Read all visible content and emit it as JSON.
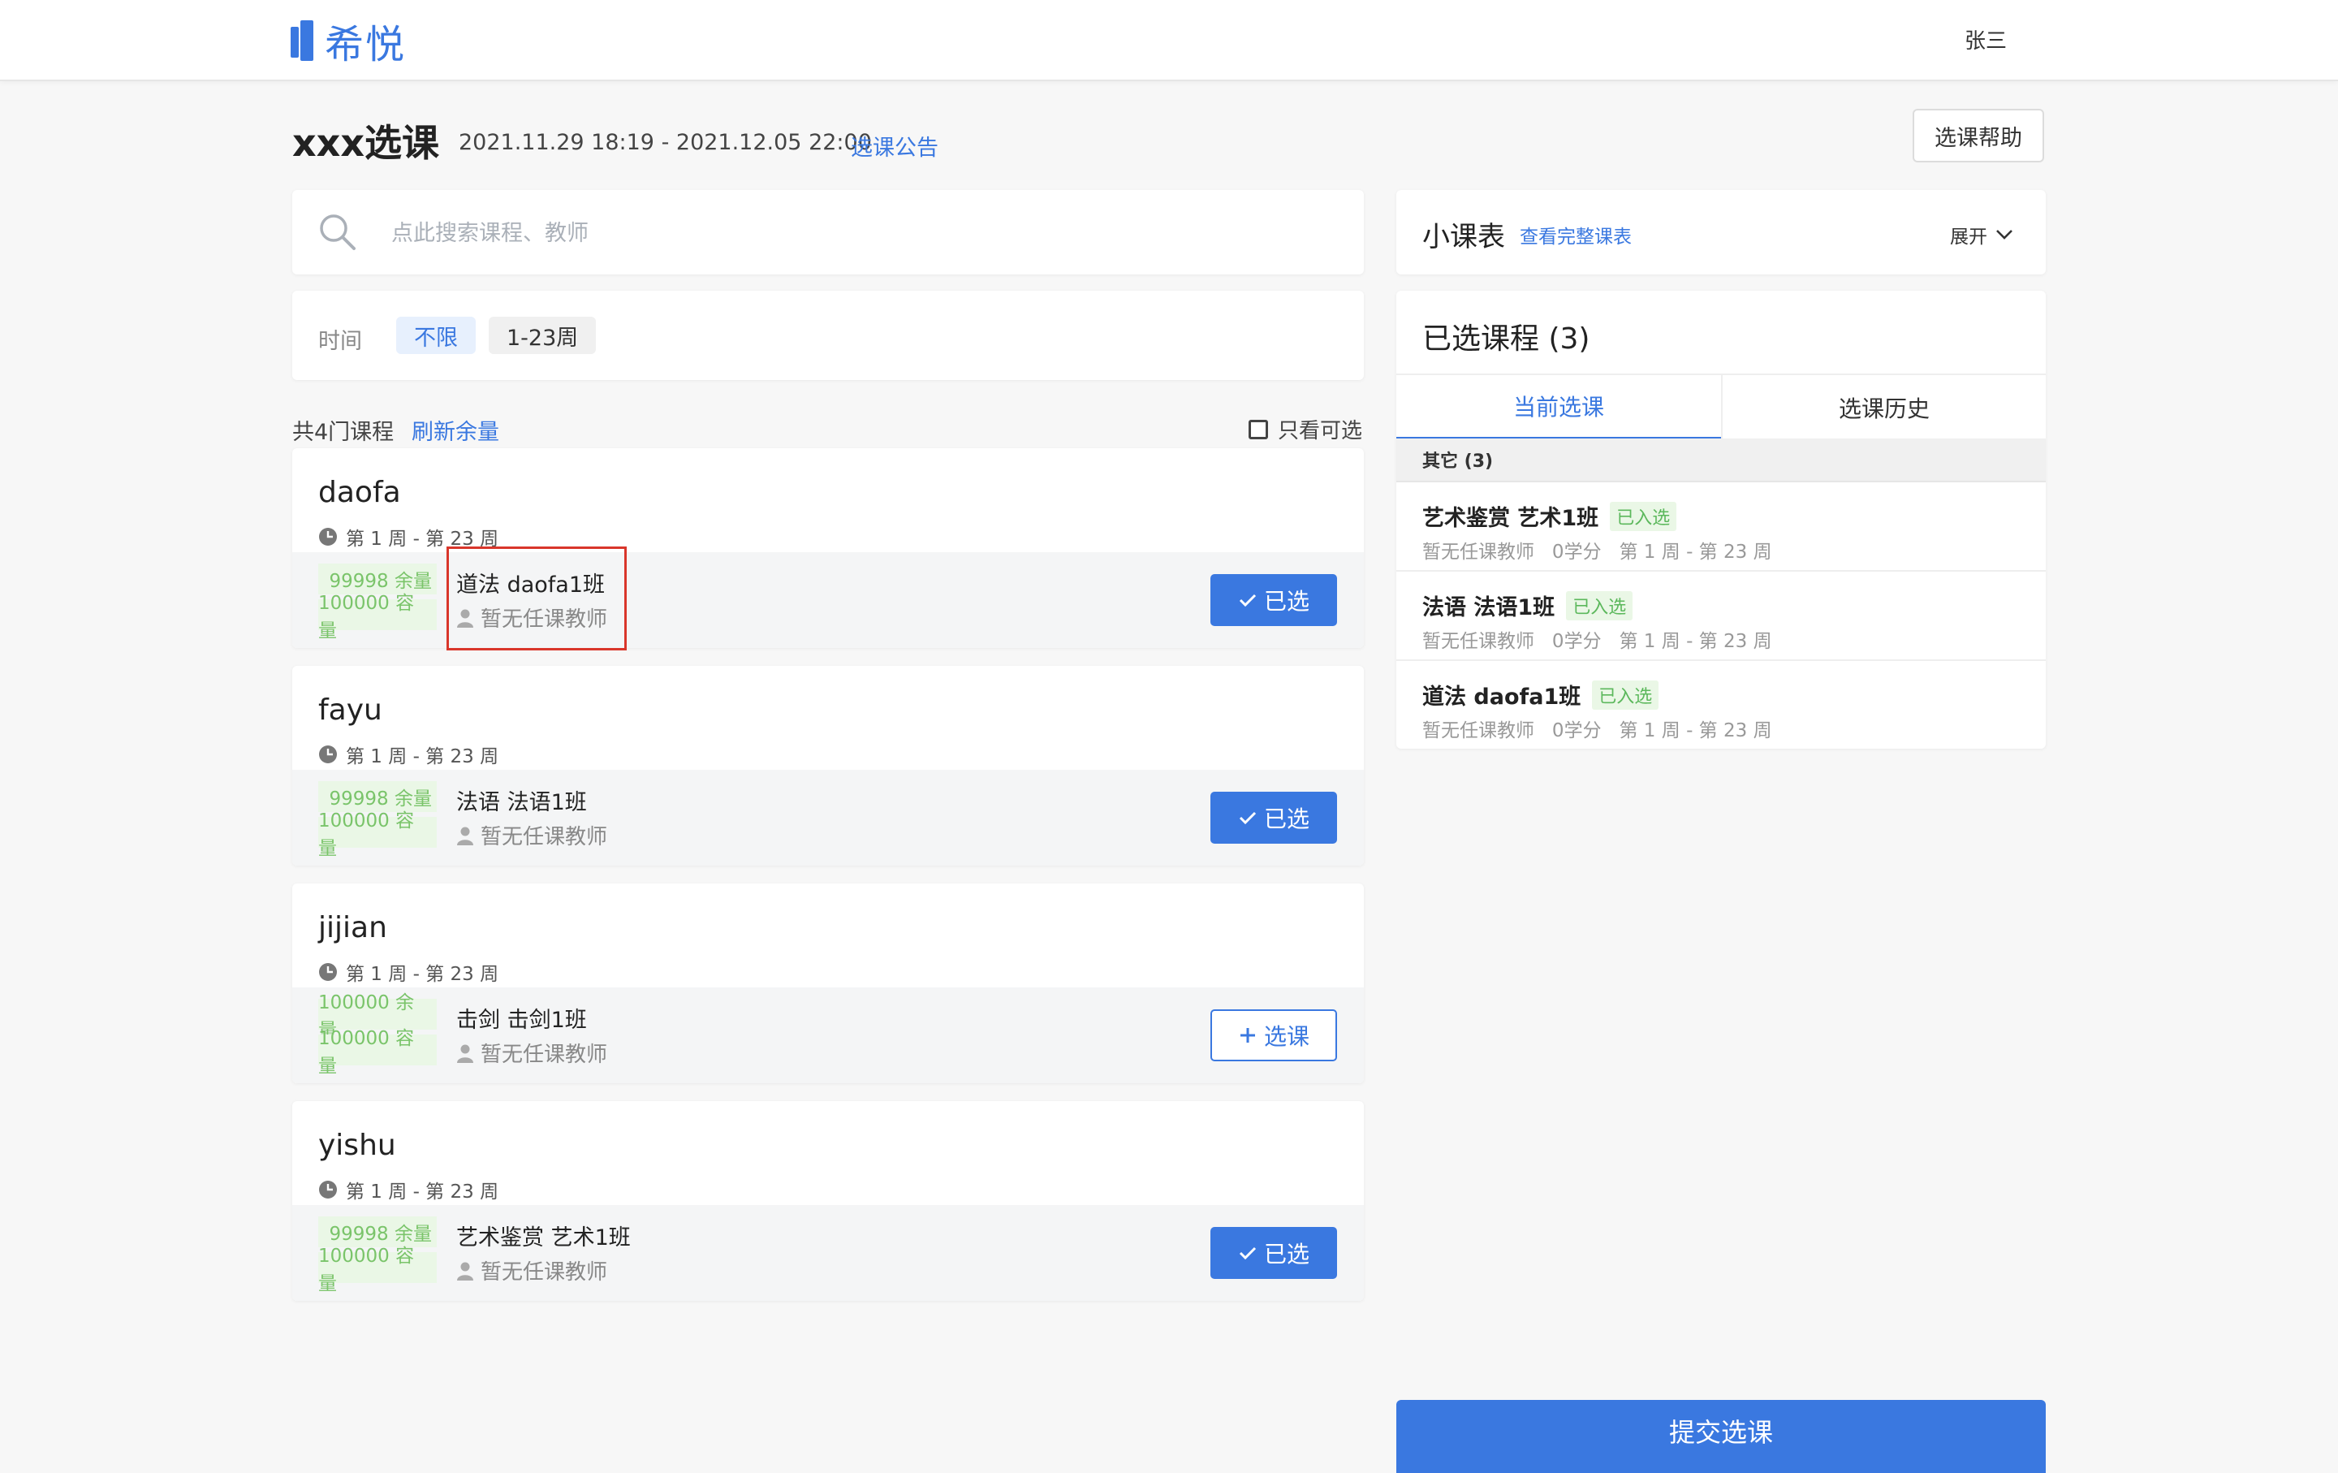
{
  "header": {
    "logo_text": "希悦",
    "user_name": "张三"
  },
  "title_row": {
    "title": "xxx选课",
    "date_range": "2021.11.29 18:19 - 2021.12.05 22:00",
    "notice_link": "选课公告",
    "help_button": "选课帮助"
  },
  "search": {
    "placeholder": "点此搜索课程、教师"
  },
  "filter": {
    "label": "时间",
    "options": [
      "不限",
      "1-23周"
    ],
    "selected": "不限"
  },
  "list_header": {
    "count_text": "共4门课程",
    "refresh_link": "刷新余量",
    "only_available_label": "只看可选",
    "only_available_checked": false
  },
  "courses": [
    {
      "name": "daofa",
      "weeks": "第 1 周 - 第 23 周",
      "remain": "99998 余量",
      "capacity": "100000 容量",
      "class_name": "道法 daofa1班",
      "teacher": "暂无任课教师",
      "button": "已选",
      "selected": true
    },
    {
      "name": "fayu",
      "weeks": "第 1 周 - 第 23 周",
      "remain": "99998 余量",
      "capacity": "100000 容量",
      "class_name": "法语 法语1班",
      "teacher": "暂无任课教师",
      "button": "已选",
      "selected": true
    },
    {
      "name": "jijian",
      "weeks": "第 1 周 - 第 23 周",
      "remain": "100000 余量",
      "capacity": "100000 容量",
      "class_name": "击剑 击剑1班",
      "teacher": "暂无任课教师",
      "button": "选课",
      "selected": false
    },
    {
      "name": "yishu",
      "weeks": "第 1 周 - 第 23 周",
      "remain": "99998 余量",
      "capacity": "100000 容量",
      "class_name": "艺术鉴赏 艺术1班",
      "teacher": "暂无任课教师",
      "button": "已选",
      "selected": true
    }
  ],
  "mini_schedule": {
    "title": "小课表",
    "link": "查看完整课表",
    "expand": "展开"
  },
  "selected_panel": {
    "title": "已选课程 (3)",
    "tabs": [
      "当前选课",
      "选课历史"
    ],
    "active_tab": "当前选课",
    "group": "其它 (3)",
    "items": [
      {
        "name": "艺术鉴赏 艺术1班",
        "tag": "已入选",
        "meta": "暂无任课教师   0学分   第 1 周 - 第 23 周"
      },
      {
        "name": "法语 法语1班",
        "tag": "已入选",
        "meta": "暂无任课教师   0学分   第 1 周 - 第 23 周"
      },
      {
        "name": "道法 daofa1班",
        "tag": "已入选",
        "meta": "暂无任课教师   0学分   第 1 周 - 第 23 周"
      }
    ]
  },
  "submit_button": "提交选课",
  "colors": {
    "primary": "#3a78e0",
    "tag_green": "#5cb85c",
    "highlight_red": "#d9362b"
  }
}
